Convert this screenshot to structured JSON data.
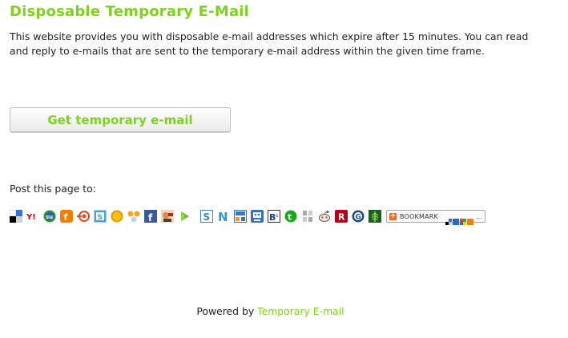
{
  "page": {
    "title": "Disposable Temporary E-Mail",
    "intro": "This website provides you with disposable e-mail addresses which expire after 15 minutes. You can read and reply to e-mails that are sent to the temporary e-mail address within the given time frame.",
    "get_button_label": "Get temporary e-mail",
    "post_label": "Post this page to:",
    "bookmark_label": "BOOKMARK",
    "footer_prefix": "Powered by",
    "footer_link": "Temporary E-mail"
  },
  "share_icons": [
    "delicious-icon",
    "yahoo-icon",
    "stumbleupon-icon",
    "blogger-icon",
    "mixx-icon",
    "slashdot-icon",
    "sun-icon",
    "netvibes-icon",
    "facebook-icon",
    "fark-icon",
    "play-icon",
    "spurl-icon",
    "newsvine-icon",
    "furl-icon",
    "blinklist-icon",
    "linkagogo-icon",
    "technorati-icon",
    "magnolia-icon",
    "reddit-icon",
    "rojo-icon",
    "google-icon",
    "tipd-icon"
  ],
  "colors": {
    "accent": "#7ed21e",
    "text": "#222222"
  }
}
